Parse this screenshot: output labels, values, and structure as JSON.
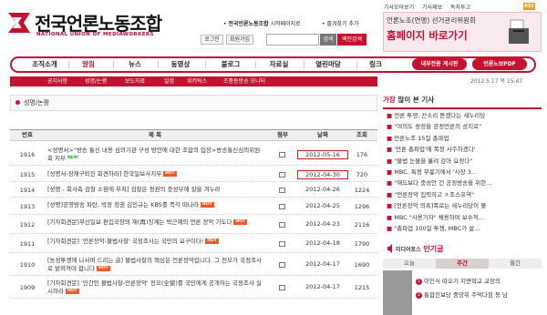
{
  "header": {
    "logo_ko": "전국언론노동조합",
    "logo_en": "NATIONAL UNION OF MEDIAWORKERS",
    "home_set_label": "전국언론노동조합",
    "home_set_suffix": "시작페이지로",
    "favorites_label": "즐겨찾기 추가",
    "login_label": "로그인",
    "join_label": "회원가입",
    "search_button": "검색",
    "detail_search_button": "엑인검색",
    "top_links": [
      "기사모아보기",
      "기사제보",
      "독자투고"
    ],
    "rss_label": "RSS"
  },
  "banner": {
    "line1": "언론노조(연맹) 선거관리위원회",
    "line2": "홈페이지 바로가기"
  },
  "nav": {
    "items": [
      "조직소개",
      "알림",
      "뉴스",
      "동영상",
      "블로그",
      "자료실",
      "열린마당",
      "링크"
    ],
    "active_index": 1,
    "pills": [
      "내부전용 게시판",
      "언론노보PDF"
    ]
  },
  "subnav": {
    "items": [
      "공지사항",
      "성명/논평",
      "보도자료",
      "일정",
      "위키릭스",
      "조중동방송 모니터"
    ]
  },
  "date_text": "2012.5.17 목 15:47",
  "section_title": "성명/논평",
  "table": {
    "headers": [
      "번호",
      "제 목",
      "첨부",
      "날짜",
      "조회"
    ],
    "rows": [
      {
        "num": "1916",
        "title": "<성명서>\"방송 통신 내용 심의기관 구성 방안에 대한 조합의 입장>방송통신심의위원회 지부",
        "badge": "NEW",
        "date": "2012-05-16",
        "views": "176"
      },
      {
        "num": "1915",
        "title": "[성명서-장재구퇴진 회견하라] 한국일보사지부",
        "badge": "HOT",
        "date": "2012-04-30",
        "views": "720"
      },
      {
        "num": "1914",
        "title": "[성명 - 회사측 검찰 소환에 부쳐] 검찰은 정권의 충성부에 칼을 겨누라",
        "badge": "",
        "date": "2012-04-26",
        "views": "1224"
      },
      {
        "num": "1913",
        "title": "[성명]공영방송 파탄, 박장 정권 김인규는 KBS를 즉각 떠나라",
        "badge": "HOT",
        "date": "2012-04-25",
        "views": "1296"
      },
      {
        "num": "1912",
        "title": "[기자회견문]부산일보 편집국장의 재(再)징계는 박근혜의 언론 장악 기도다",
        "badge": "HOT",
        "date": "2012-04-23",
        "views": "2116"
      },
      {
        "num": "1911",
        "title": "[기자회견문] '언론장악-불법사찰' 국정조사는 국민의 요구이다!",
        "badge": "HOT",
        "date": "2012-04-18",
        "views": "1790"
      },
      {
        "num": "1910",
        "title": "[농성투쟁에 나서며 드리는 글] 불법사찰의 핵심은 언론장악입니다. 그 전모가 국정조사로 밝혀져야 합니다",
        "badge": "HOT",
        "date": "2012-04-17",
        "views": "1690"
      },
      {
        "num": "1909",
        "title": "[기자회견문] '민간인 불법사찰-언론장악' 전모(全貌)를 국민에게 공개하는 국정조사 실시하라",
        "badge": "HOT",
        "date": "2012-04-17",
        "views": "1215"
      }
    ],
    "highlight_dates": [
      0,
      1
    ]
  },
  "sidebar": {
    "popular_title_red": "가장",
    "popular_title_rest": " 많이 본 기사",
    "popular_items": [
      "언론 투쟁, 끈소리 듣겠다는 새누리당",
      "\"여의도 왕장을 공정언론의 성지로\"",
      "언론노조 15일 총파업",
      "'언론 총파업'에 폭정 사주하겠다'",
      "\"불법 눈물을 흘려 감아 요정다\"",
      "MBC, 특정 무릎기에서 '사장 3...",
      "\"해도보다 충성안 건 공정방송을 위한...",
      "\"언론장악 집력하고 ㅈ조스유역\"",
      "[언론장악 의혹]폭로는 새누리당이 볼",
      "MBC \"사용기자\" 채용하여 보수적...",
      "\"총파업 100일 투쟁, MBC가 삶..."
    ],
    "ranking_title_small": "미디어포스",
    "ranking_title_red": "인기글",
    "ranking_tabs": [
      "오늘",
      "주간",
      "월간"
    ],
    "ranking_active": 1,
    "ranking_items": [
      "이인식 따오기 지면학교 교장의",
      "통합진보당 중앙위 주먹다짐 등 남"
    ]
  },
  "colors": {
    "brand": "#c4122f",
    "hot_badge": "#f15a24",
    "new_badge": "#2aa52a"
  }
}
